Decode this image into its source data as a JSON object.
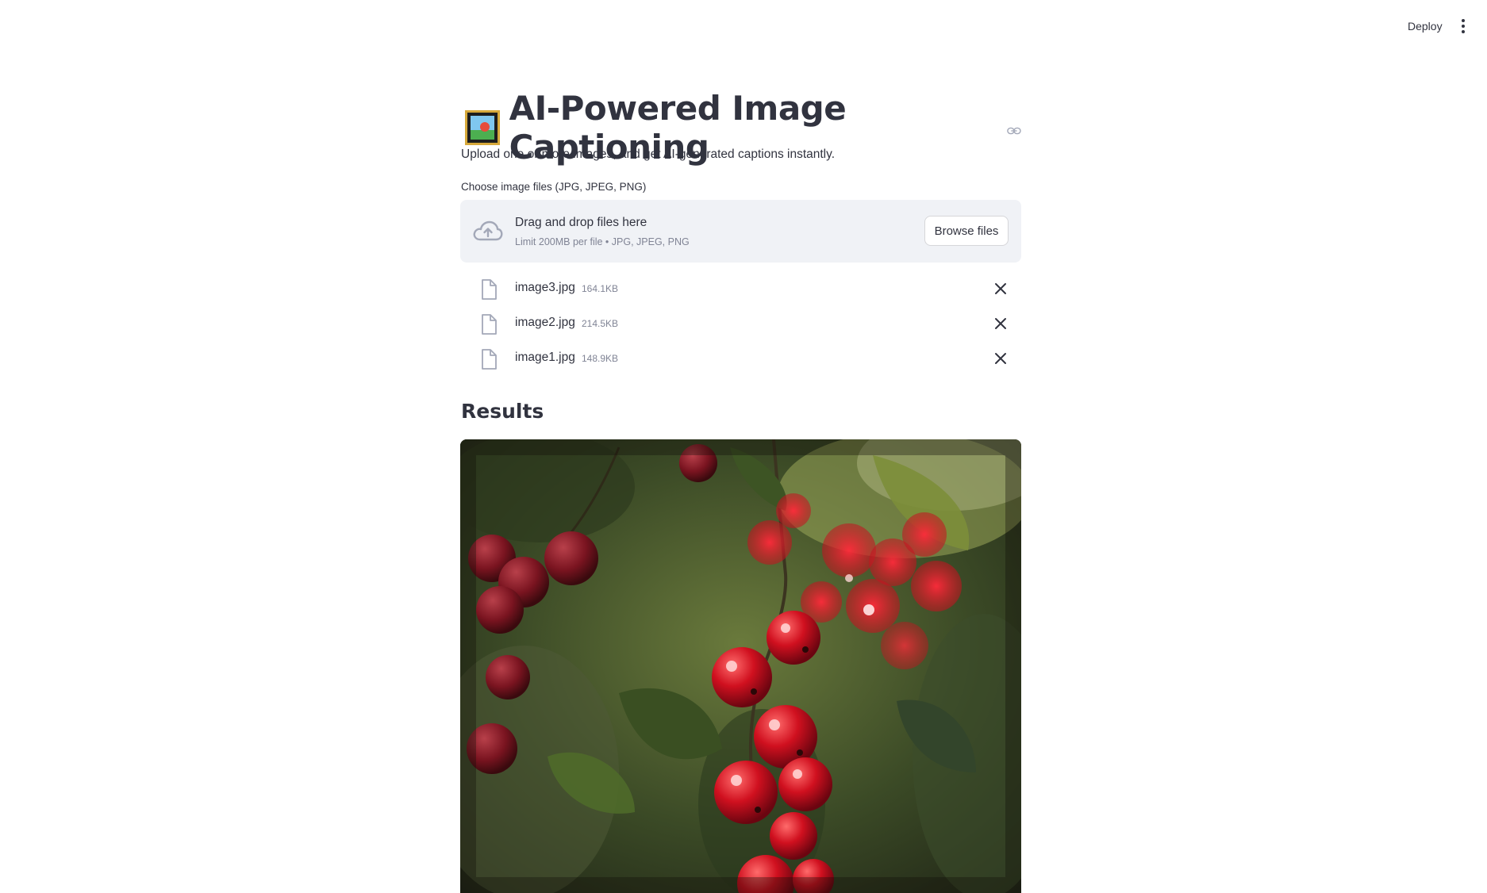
{
  "header": {
    "deploy_label": "Deploy",
    "menu_icon": "kebab-menu-icon"
  },
  "page": {
    "title_icon": "framed-picture-icon",
    "title": "AI-Powered Image Captioning",
    "subtitle": "Upload one or more images, and get AI-generated captions instantly."
  },
  "uploader": {
    "label": "Choose image files (JPG, JPEG, PNG)",
    "drop_title": "Drag and drop files here",
    "drop_subtitle": "Limit 200MB per file • JPG, JPEG, PNG",
    "browse_label": "Browse files",
    "files": [
      {
        "name": "image3.jpg",
        "size": "164.1KB"
      },
      {
        "name": "image2.jpg",
        "size": "214.5KB"
      },
      {
        "name": "image1.jpg",
        "size": "148.9KB"
      }
    ]
  },
  "results": {
    "heading": "Results",
    "image_subject": "red currants on branch"
  },
  "colors": {
    "text": "#31333f",
    "muted": "#808495",
    "dropzone_bg": "#f0f2f6",
    "icon": "#a3a8b8"
  }
}
